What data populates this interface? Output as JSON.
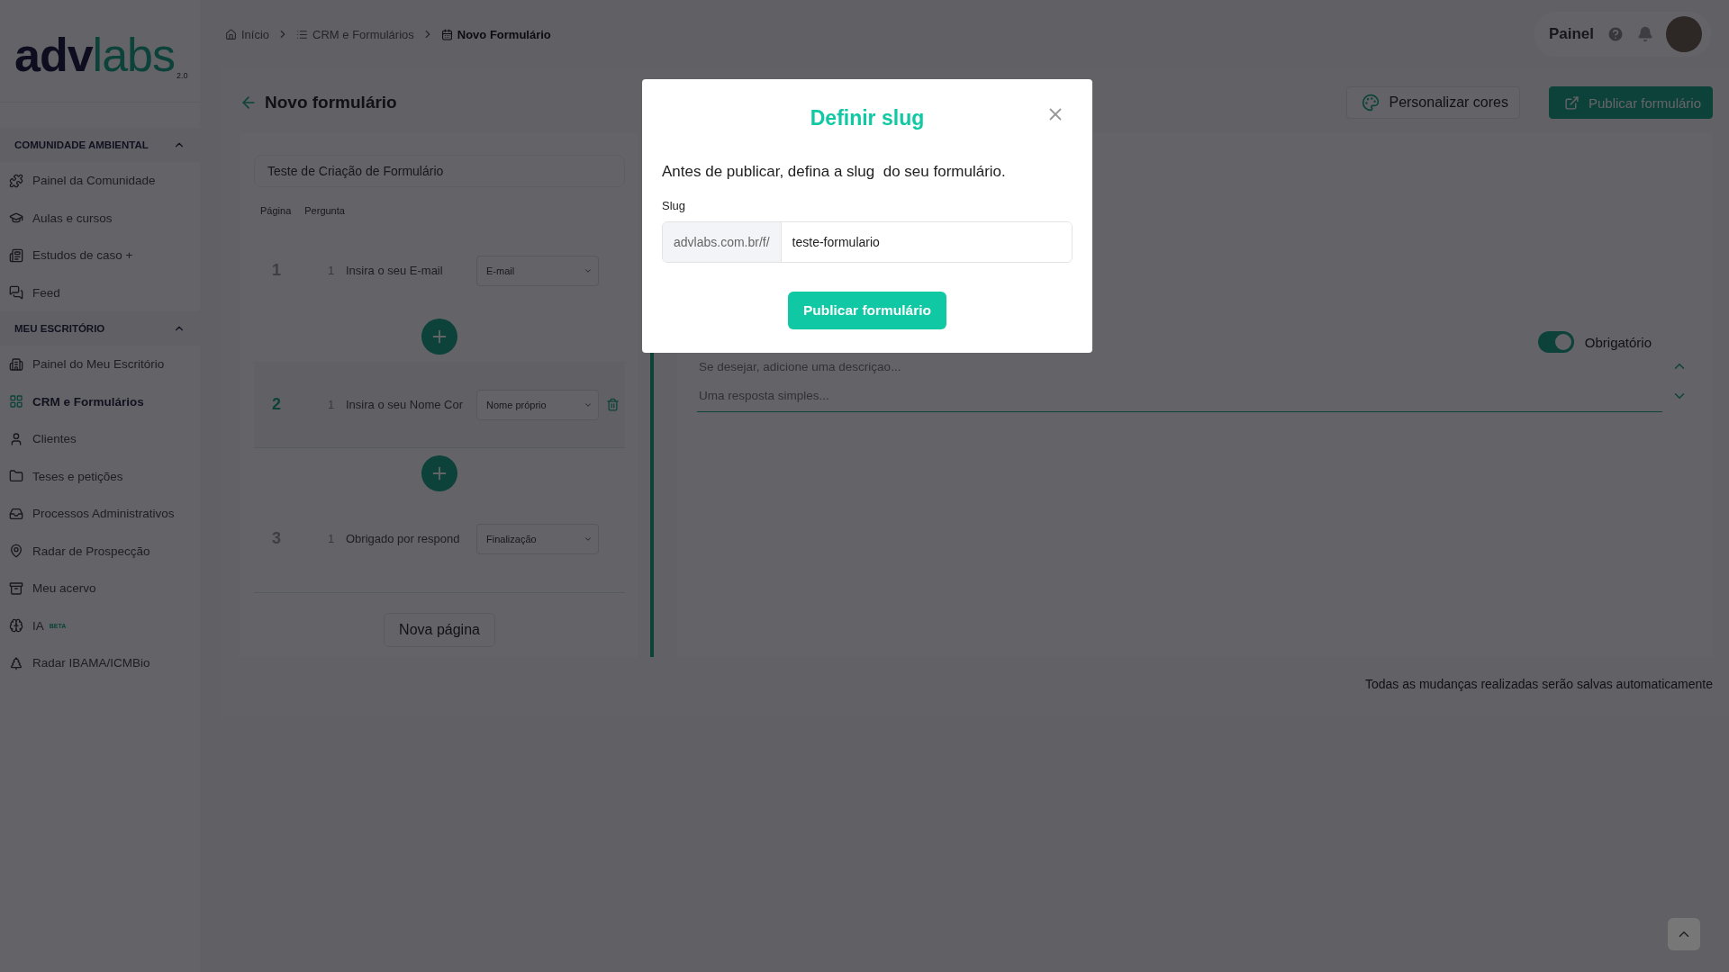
{
  "logo": {
    "part1": "adv",
    "part2": "labs",
    "version": "2.0"
  },
  "sidebar": {
    "sections": [
      {
        "title": "COMUNIDADE AMBIENTAL",
        "expanded": true,
        "items": [
          {
            "label": "Painel da Comunidade",
            "selected": false
          },
          {
            "label": "Aulas e cursos",
            "selected": false
          },
          {
            "label": "Estudos de caso +",
            "selected": false
          },
          {
            "label": "Feed",
            "selected": false
          }
        ]
      },
      {
        "title": "MEU ESCRITÓRIO",
        "expanded": true,
        "items": [
          {
            "label": "Painel do Meu Escritório",
            "selected": false
          },
          {
            "label": "CRM e Formulários",
            "selected": true
          },
          {
            "label": "Clientes",
            "selected": false
          },
          {
            "label": "Teses e petições",
            "selected": false
          },
          {
            "label": "Processos Administrativos",
            "selected": false
          },
          {
            "label": "Radar de Prospecção",
            "selected": false
          },
          {
            "label": "Meu acervo",
            "selected": false
          },
          {
            "label": "IA",
            "badge": "BETA",
            "selected": false
          },
          {
            "label": "Radar IBAMA/ICMBio",
            "selected": false
          }
        ]
      }
    ]
  },
  "breadcrumb": [
    {
      "label": "Início",
      "current": false
    },
    {
      "label": "CRM e Formulários",
      "current": false
    },
    {
      "label": "Novo Formulário",
      "current": true
    }
  ],
  "topbar": {
    "label": "Painel"
  },
  "page": {
    "title": "Novo formulário",
    "buttons": [
      {
        "label": "Personalizar cores",
        "kind": "outline"
      },
      {
        "label": "Publicar formulário",
        "kind": "primary"
      }
    ]
  },
  "form": {
    "name": "Teste de Criação de Formulário",
    "columns": [
      "Página",
      "Pergunta"
    ],
    "questions": [
      {
        "page": "1",
        "number": "1",
        "text": "Insira o seu E-mail",
        "type": "E-mail",
        "selected": false
      },
      {
        "page": "2",
        "number": "1",
        "text": "Insira o seu Nome Cor",
        "type": "Nome próprio",
        "selected": true
      },
      {
        "page": "3",
        "number": "1",
        "text": "Obrigado por respond",
        "type": "Finalização",
        "selected": false
      }
    ],
    "new_page": "Nova página"
  },
  "editor": {
    "required": {
      "label": "Obrigatório",
      "on": true
    },
    "description_placeholder": "Se desejar, adicione uma descriçao...",
    "answer_placeholder": "Uma resposta simples..."
  },
  "footer": "Todas as mudanças realizadas serão salvas automaticamente",
  "modal": {
    "title": "Definir slug",
    "text": "Antes de publicar, defina a slug  do seu formulário.",
    "field_label": "Slug",
    "prefix": "advlabs.com.br/f/",
    "value": "teste-formulario",
    "button": "Publicar formulário"
  }
}
